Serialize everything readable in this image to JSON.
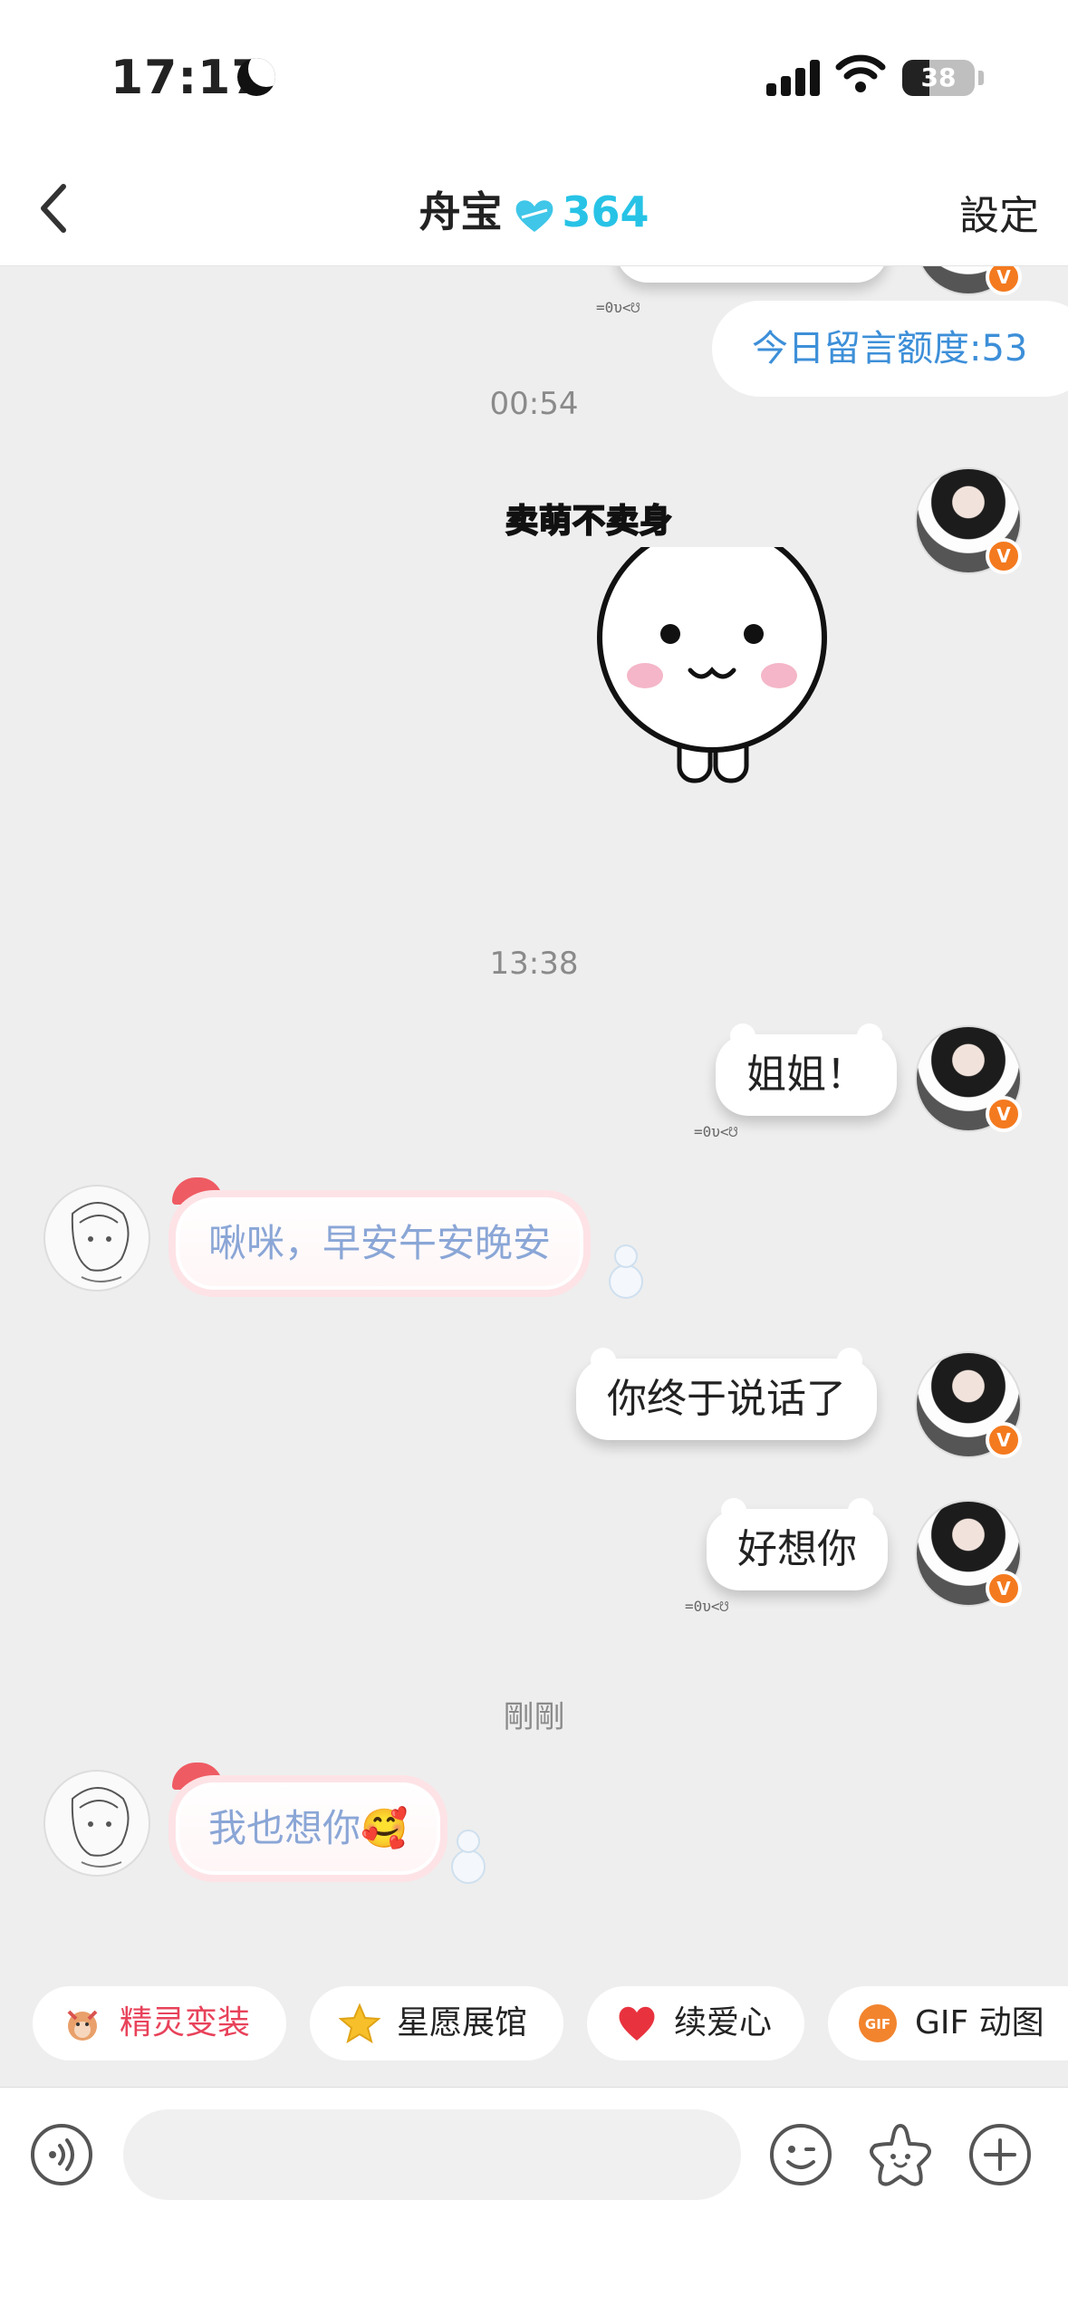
{
  "status_bar": {
    "time": "17:17",
    "battery": "38"
  },
  "nav": {
    "title": "舟宝",
    "score": "364",
    "settings_label": "設定"
  },
  "quota": {
    "text": "今日留言额度:53"
  },
  "read_receipt": "=0υ<☋",
  "timestamps": {
    "t1": "00:54",
    "t2": "13:38",
    "t3": "剛剛"
  },
  "sticker": {
    "caption": "卖萌不卖身"
  },
  "messages": {
    "m1": "姐姐！",
    "m2": "啾咪，早安午安晚安",
    "m3": "你终于说话了",
    "m4": "好想你",
    "m5": "我也想你🥰"
  },
  "chips": [
    {
      "label": "精灵变装",
      "color": "#e8425a"
    },
    {
      "label": "星愿展馆",
      "color": "#333333"
    },
    {
      "label": "续爱心",
      "color": "#333333"
    },
    {
      "label": "GIF 动图",
      "color": "#333333"
    }
  ],
  "input": {
    "placeholder": ""
  }
}
